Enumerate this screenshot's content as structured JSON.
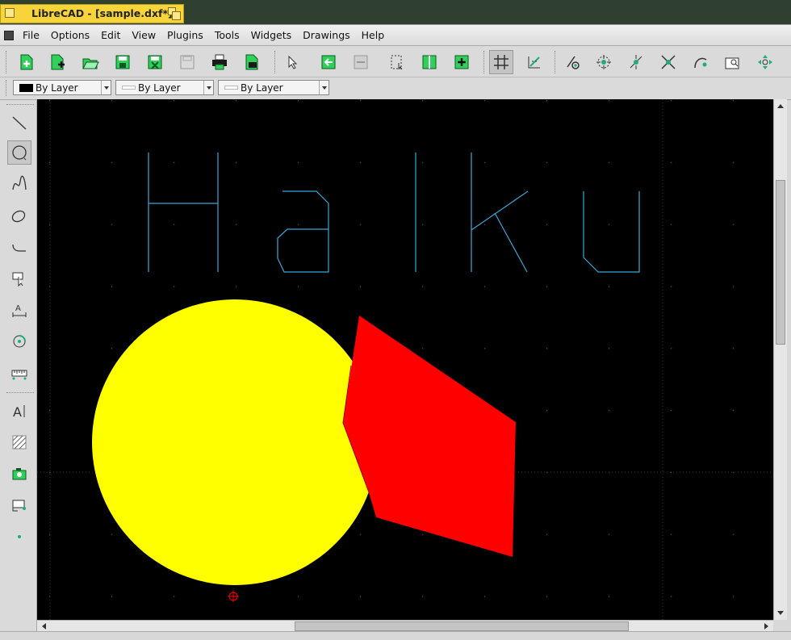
{
  "window": {
    "title": "LibreCAD - [sample.dxf*]"
  },
  "menu": [
    "File",
    "Options",
    "Edit",
    "View",
    "Plugins",
    "Tools",
    "Widgets",
    "Drawings",
    "Help"
  ],
  "toolbar": {
    "icons": [
      "new-file-icon",
      "new-from-template-icon",
      "open-file-icon",
      "save-icon",
      "save-as-icon",
      "save-disabled-icon",
      "print-icon",
      "print-preview-icon",
      "select-pointer-icon",
      "block-insert-icon",
      "block-disabled-icon",
      "select-window-icon",
      "layer-panel-icon",
      "add-block-icon",
      "grid-icon",
      "draft-mode-icon",
      "snap-free-icon",
      "snap-grid-icon",
      "snap-endpoint-icon",
      "snap-intersection-icon",
      "snap-tangent-icon",
      "zoom-window-icon",
      "zoom-pan-icon"
    ]
  },
  "pen": {
    "color_label": "By Layer",
    "width_label": "By Layer",
    "type_label": "By Layer"
  },
  "toolbox": {
    "icons": [
      "line-tool-icon",
      "circle-tool-icon",
      "spline-tool-icon",
      "ellipse-tool-icon",
      "polyline-tool-icon",
      "select-tool-icon",
      "dimension-tool-icon",
      "modify-tool-icon",
      "measure-tool-icon",
      "text-tool-icon",
      "hatch-tool-icon",
      "image-tool-icon",
      "block-tool-icon",
      "point-tool-icon"
    ]
  },
  "drawing": {
    "text": "Haiku",
    "colors": {
      "text_lines": "#3aa6d8",
      "circle_fill": "#ffff00",
      "polygon_fill": "#ff0000",
      "background": "#000000",
      "origin_marker": "#ff0000"
    }
  }
}
